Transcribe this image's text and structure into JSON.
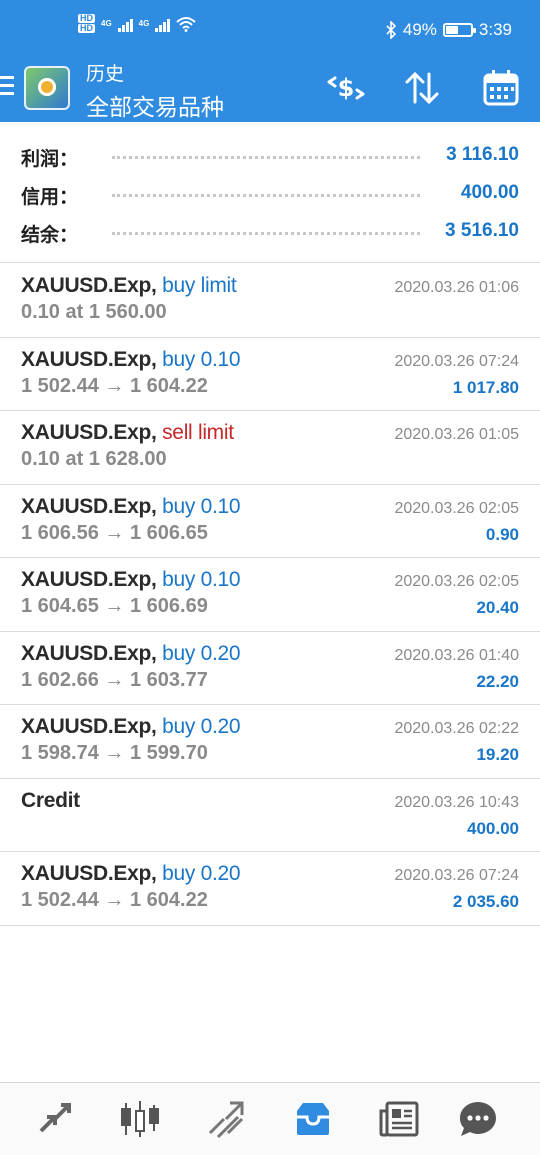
{
  "status_bar": {
    "hd_labels": [
      "HD",
      "HD"
    ],
    "network_1": "4G",
    "network_2": "4G",
    "battery_percent": "49%",
    "battery_level": 0.49,
    "time": "3:39",
    "icons": [
      "bluetooth-icon",
      "wifi-icon",
      "battery-icon"
    ]
  },
  "header": {
    "title": "历史",
    "subtitle": "全部交易品种",
    "background": "#2f8ce0",
    "actions": [
      "symbol-filter-icon",
      "sort-icon",
      "calendar-icon"
    ]
  },
  "summary": [
    {
      "label": "利润：",
      "value": "3 116.10"
    },
    {
      "label": "信用：",
      "value": "400.00"
    },
    {
      "label": "结余：",
      "value": "3 516.10"
    }
  ],
  "deals": [
    {
      "symbol": "XAUUSD.Exp,",
      "type": "buy limit",
      "side": "buy",
      "details": "0.10 at 1 560.00",
      "time": "2020.03.26 01:06",
      "profit": ""
    },
    {
      "symbol": "XAUUSD.Exp,",
      "type": "buy 0.10",
      "side": "buy",
      "details": "1 502.44 → 1 604.22",
      "time": "2020.03.26 07:24",
      "profit": "1 017.80"
    },
    {
      "symbol": "XAUUSD.Exp,",
      "type": "sell limit",
      "side": "sell",
      "details": "0.10 at 1 628.00",
      "time": "2020.03.26 01:05",
      "profit": ""
    },
    {
      "symbol": "XAUUSD.Exp,",
      "type": "buy 0.10",
      "side": "buy",
      "details": "1 606.56 → 1 606.65",
      "time": "2020.03.26 02:05",
      "profit": "0.90"
    },
    {
      "symbol": "XAUUSD.Exp,",
      "type": "buy 0.10",
      "side": "buy",
      "details": "1 604.65 → 1 606.69",
      "time": "2020.03.26 02:05",
      "profit": "20.40"
    },
    {
      "symbol": "XAUUSD.Exp,",
      "type": "buy 0.20",
      "side": "buy",
      "details": "1 602.66 → 1 603.77",
      "time": "2020.03.26 01:40",
      "profit": "22.20"
    },
    {
      "symbol": "XAUUSD.Exp,",
      "type": "buy 0.20",
      "side": "buy",
      "details": "1 598.74 → 1 599.70",
      "time": "2020.03.26 02:22",
      "profit": "19.20"
    },
    {
      "symbol": "Credit",
      "type": "",
      "side": "none",
      "details": "",
      "time": "2020.03.26 10:43",
      "profit": "400.00"
    },
    {
      "symbol": "XAUUSD.Exp,",
      "type": "buy 0.20",
      "side": "buy",
      "details": "1 502.44 → 1 604.22",
      "time": "2020.03.26 07:24",
      "profit": "2 035.60"
    }
  ],
  "bottom_nav": [
    {
      "icon": "quotes-icon",
      "active": false
    },
    {
      "icon": "chart-icon",
      "active": false
    },
    {
      "icon": "trade-icon",
      "active": false
    },
    {
      "icon": "history-icon",
      "active": true
    },
    {
      "icon": "news-icon",
      "active": false
    },
    {
      "icon": "chat-icon",
      "active": false
    }
  ],
  "colors": {
    "accent": "#2f8ce0",
    "value_blue": "#1976c8",
    "sell_red": "#c62828",
    "muted": "#8a8a8a"
  }
}
